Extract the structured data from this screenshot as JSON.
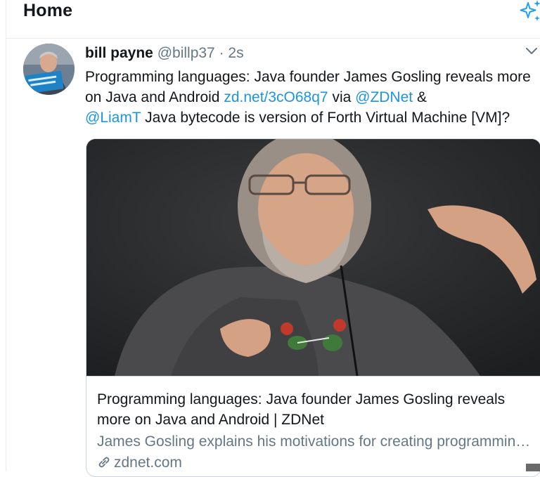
{
  "header": {
    "title": "Home",
    "sparkle_icon": "sparkle-icon"
  },
  "tweet": {
    "author_name": "bill payne",
    "author_handle": "@billp37",
    "separator": "·",
    "time": "2s",
    "text_parts": {
      "t1": "Programming languages: Java founder James Gosling reveals more on Java and Android ",
      "link": "zd.net/3cO68q7",
      "t2": " via ",
      "mention1": "@ZDNet",
      "t3": " & ",
      "mention2": "@LiamT",
      "t4": " Java bytecode is version of Forth Virtual Machine [VM]?"
    },
    "card": {
      "title": "Programming languages: Java founder James Gosling reveals more on Java and Android | ZDNet",
      "description": "James Gosling explains his motivations for creating programming languages Java and more",
      "domain": "zdnet.com"
    }
  },
  "colors": {
    "link": "#1b95e0",
    "secondary_text": "#657786",
    "border": "#ccd6dd"
  }
}
